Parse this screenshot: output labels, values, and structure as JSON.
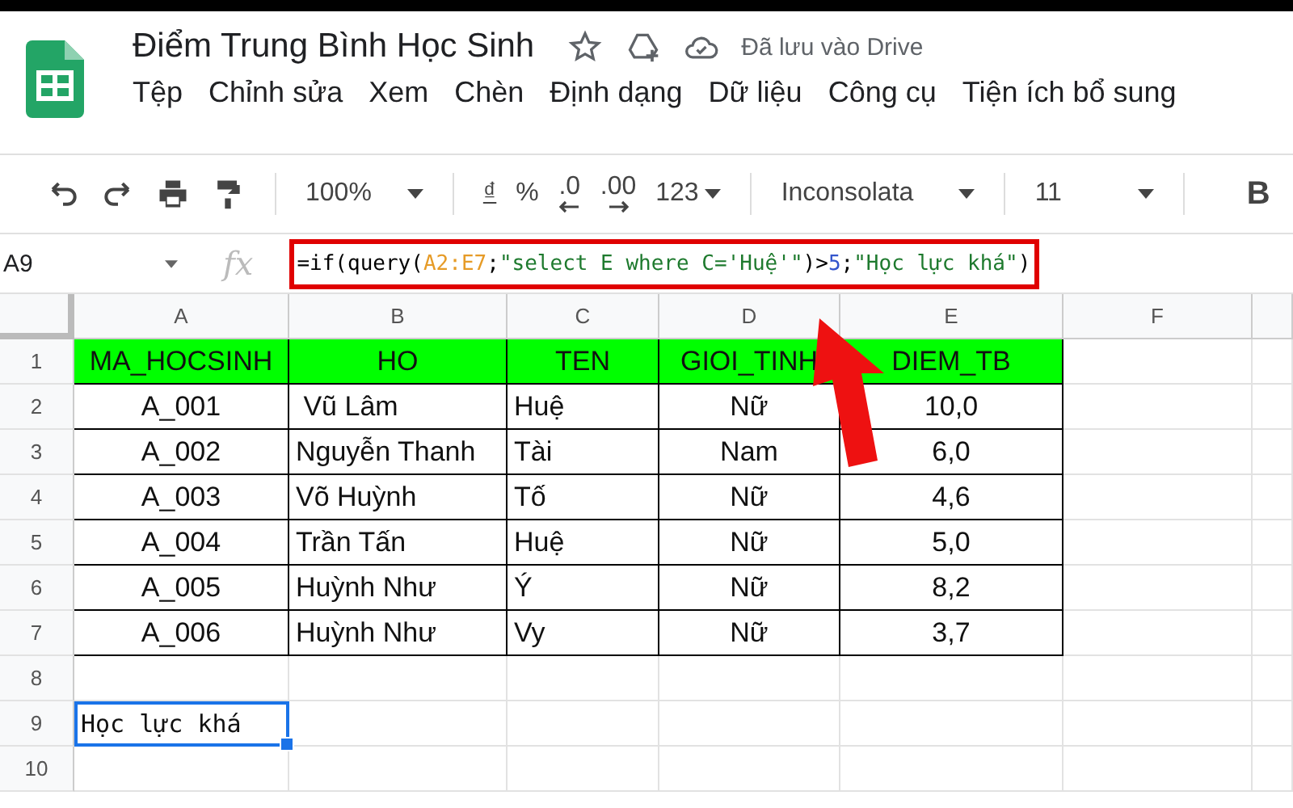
{
  "document": {
    "title": "Điểm Trung Bình Học Sinh",
    "save_status": "Đã lưu vào Drive"
  },
  "menu": [
    "Tệp",
    "Chỉnh sửa",
    "Xem",
    "Chèn",
    "Định dạng",
    "Dữ liệu",
    "Công cụ",
    "Tiện ích bổ sung"
  ],
  "toolbar": {
    "zoom": "100%",
    "currency": "₫",
    "percent": "%",
    "decrease_decimal": ".0",
    "increase_decimal": ".00",
    "number_format": "123",
    "font": "Inconsolata",
    "font_size": "11",
    "bold": "B"
  },
  "formula_bar": {
    "cell_name": "A9",
    "fx": "fx",
    "highlighted": true,
    "formula": [
      {
        "text": "=if(query(",
        "color": "#000000"
      },
      {
        "text": "A2:E7",
        "color": "#e69b27"
      },
      {
        "text": ";",
        "color": "#000000"
      },
      {
        "text": "\"select E where C='Huệ'\"",
        "color": "#1e7a2e"
      },
      {
        "text": ")>",
        "color": "#000000"
      },
      {
        "text": "5",
        "color": "#3355cc"
      },
      {
        "text": ";",
        "color": "#000000"
      },
      {
        "text": "\"Học lực khá\"",
        "color": "#1e7a2e"
      },
      {
        "text": ")",
        "color": "#000000"
      }
    ]
  },
  "sheet": {
    "columns": [
      "A",
      "B",
      "C",
      "D",
      "E",
      "F"
    ],
    "rows": [
      {
        "number": "1",
        "kind": "header",
        "cells": [
          {
            "text": "MA_HOCSINH",
            "selected": false
          },
          {
            "text": "HO",
            "selected": false
          },
          {
            "text": "TEN",
            "selected": false
          },
          {
            "text": "GIOI_TINH",
            "selected": false
          },
          {
            "text": "DIEM_TB",
            "selected": false
          }
        ]
      },
      {
        "number": "2",
        "kind": "data",
        "cells": [
          {
            "text": "A_001",
            "selected": false
          },
          {
            "text": " Vũ Lâm",
            "selected": false
          },
          {
            "text": "Huệ",
            "selected": false
          },
          {
            "text": "Nữ",
            "selected": false
          },
          {
            "text": "10,0",
            "selected": false
          }
        ]
      },
      {
        "number": "3",
        "kind": "data",
        "cells": [
          {
            "text": "A_002",
            "selected": false
          },
          {
            "text": "Nguyễn Thanh",
            "selected": false
          },
          {
            "text": "Tài",
            "selected": false
          },
          {
            "text": "Nam",
            "selected": false
          },
          {
            "text": "6,0",
            "selected": false
          }
        ]
      },
      {
        "number": "4",
        "kind": "data",
        "cells": [
          {
            "text": "A_003",
            "selected": false
          },
          {
            "text": "Võ Huỳnh",
            "selected": false
          },
          {
            "text": "Tố",
            "selected": false
          },
          {
            "text": "Nữ",
            "selected": false
          },
          {
            "text": "4,6",
            "selected": false
          }
        ]
      },
      {
        "number": "5",
        "kind": "data",
        "cells": [
          {
            "text": "A_004",
            "selected": false
          },
          {
            "text": "Trần Tấn",
            "selected": false
          },
          {
            "text": "Huệ",
            "selected": false
          },
          {
            "text": "Nữ",
            "selected": false
          },
          {
            "text": "5,0",
            "selected": false
          }
        ]
      },
      {
        "number": "6",
        "kind": "data",
        "cells": [
          {
            "text": "A_005",
            "selected": false
          },
          {
            "text": "Huỳnh Như",
            "selected": false
          },
          {
            "text": "Ý",
            "selected": false
          },
          {
            "text": "Nữ",
            "selected": false
          },
          {
            "text": "8,2",
            "selected": false
          }
        ]
      },
      {
        "number": "7",
        "kind": "data",
        "cells": [
          {
            "text": "A_006",
            "selected": false
          },
          {
            "text": "Huỳnh Như",
            "selected": false
          },
          {
            "text": "Vy",
            "selected": false
          },
          {
            "text": "Nữ",
            "selected": false
          },
          {
            "text": "3,7",
            "selected": false
          }
        ]
      },
      {
        "number": "8",
        "kind": "plain",
        "cells": []
      },
      {
        "number": "9",
        "kind": "plain",
        "cells": [
          {
            "text": "Học lực khá",
            "selected": true
          }
        ]
      },
      {
        "number": "10",
        "kind": "plain",
        "cells": []
      }
    ]
  },
  "annotation": {
    "arrow": true
  }
}
